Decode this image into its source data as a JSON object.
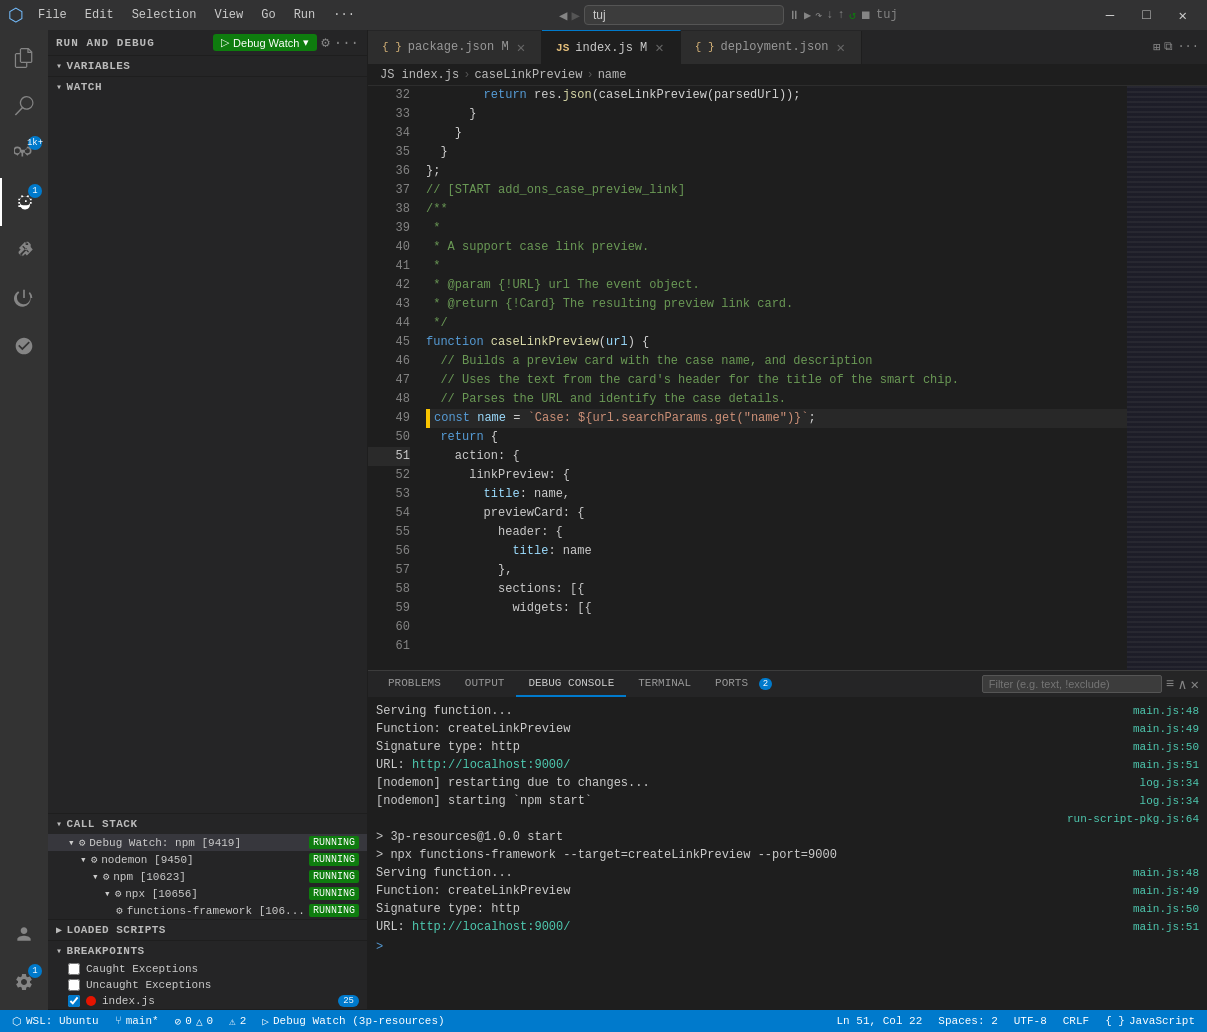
{
  "titleBar": {
    "menuItems": [
      "File",
      "Edit",
      "Selection",
      "View",
      "Go",
      "Run",
      "···"
    ],
    "searchPlaceholder": "tuj",
    "windowControls": [
      "—",
      "□",
      "✕"
    ]
  },
  "activityBar": {
    "icons": [
      {
        "name": "explorer-icon",
        "symbol": "⎘",
        "active": false
      },
      {
        "name": "search-icon",
        "symbol": "🔍",
        "active": false
      },
      {
        "name": "source-control-icon",
        "symbol": "⑂",
        "badge": "1k+",
        "active": false
      },
      {
        "name": "debug-icon",
        "symbol": "▷",
        "active": true,
        "badge": "1"
      },
      {
        "name": "extensions-icon",
        "symbol": "⊞",
        "active": false
      },
      {
        "name": "testing-icon",
        "symbol": "⚗",
        "active": false
      },
      {
        "name": "remote-icon",
        "symbol": "⚙",
        "active": false
      }
    ],
    "bottomIcons": [
      {
        "name": "account-icon",
        "symbol": "👤"
      },
      {
        "name": "settings-icon",
        "symbol": "⚙",
        "badge": "1"
      }
    ]
  },
  "sidebar": {
    "title": "RUN AND DEBUG",
    "debugConfig": "Debug Watch",
    "sections": {
      "variables": {
        "label": "VARIABLES",
        "collapsed": false
      },
      "watch": {
        "label": "WATCH",
        "collapsed": false
      },
      "callStack": {
        "label": "CALL STACK",
        "items": [
          {
            "icon": "⚙",
            "label": "Debug Watch: npm [9419]",
            "status": "RUNNING",
            "children": [
              {
                "icon": "⚙",
                "label": "nodemon [9450]",
                "status": "RUNNING",
                "children": [
                  {
                    "icon": "⚙",
                    "label": "npm [10623]",
                    "status": "RUNNING",
                    "children": [
                      {
                        "icon": "⚙",
                        "label": "npx [10656]",
                        "status": "RUNNING",
                        "children": [
                          {
                            "icon": "⚙",
                            "label": "functions-framework [106...",
                            "status": "RUNNING"
                          }
                        ]
                      }
                    ]
                  }
                ]
              }
            ]
          }
        ]
      },
      "loadedScripts": {
        "label": "LOADED SCRIPTS",
        "collapsed": true
      },
      "breakpoints": {
        "label": "BREAKPOINTS",
        "items": [
          {
            "type": "checkbox",
            "label": "Caught Exceptions",
            "checked": false
          },
          {
            "type": "checkbox",
            "label": "Uncaught Exceptions",
            "checked": false
          },
          {
            "type": "dot",
            "label": "index.js",
            "checked": true,
            "count": "25"
          }
        ]
      }
    }
  },
  "tabs": [
    {
      "label": "package.json",
      "icon": "{ }",
      "modified": true,
      "active": false
    },
    {
      "label": "index.js",
      "icon": "JS",
      "modified": true,
      "active": true
    },
    {
      "label": "deployment.json",
      "icon": "{ }",
      "active": false
    }
  ],
  "breadcrumb": [
    "JS index.js",
    "caseLinkPreview",
    "name"
  ],
  "editor": {
    "lines": [
      {
        "num": 32,
        "content": "        return res.json(caseLinkPreview(parsedUrl));",
        "tokens": [
          {
            "text": "        ",
            "class": ""
          },
          {
            "text": "return",
            "class": "kw"
          },
          {
            "text": " res.",
            "class": ""
          },
          {
            "text": "json",
            "class": "fn"
          },
          {
            "text": "(caseLinkPreview(parsedUrl));",
            "class": ""
          }
        ]
      },
      {
        "num": 33,
        "content": "      }",
        "tokens": [
          {
            "text": "      }",
            "class": "punc"
          }
        ]
      },
      {
        "num": 34,
        "content": "    }",
        "tokens": [
          {
            "text": "    }",
            "class": "punc"
          }
        ]
      },
      {
        "num": 35,
        "content": "  }",
        "tokens": [
          {
            "text": "  }",
            "class": "punc"
          }
        ]
      },
      {
        "num": 36,
        "content": "};",
        "tokens": [
          {
            "text": "};",
            "class": "punc"
          }
        ]
      },
      {
        "num": 37,
        "content": "",
        "tokens": []
      },
      {
        "num": 38,
        "content": "// [START add_ons_case_preview_link]",
        "tokens": [
          {
            "text": "// [START add_ons_case_preview_link]",
            "class": "comment"
          }
        ]
      },
      {
        "num": 39,
        "content": "",
        "tokens": []
      },
      {
        "num": 40,
        "content": "/**",
        "tokens": [
          {
            "text": "/**",
            "class": "comment"
          }
        ]
      },
      {
        "num": 41,
        "content": " *",
        "tokens": [
          {
            "text": " *",
            "class": "comment"
          }
        ]
      },
      {
        "num": 42,
        "content": " * A support case link preview.",
        "tokens": [
          {
            "text": " * A support case link preview.",
            "class": "comment"
          }
        ]
      },
      {
        "num": 43,
        "content": " *",
        "tokens": [
          {
            "text": " *",
            "class": "comment"
          }
        ]
      },
      {
        "num": 44,
        "content": " * @param {!URL} url The event object.",
        "tokens": [
          {
            "text": " * @param {!URL} url The event object.",
            "class": "comment"
          }
        ]
      },
      {
        "num": 45,
        "content": " * @return {!Card} The resulting preview link card.",
        "tokens": [
          {
            "text": " * @return {!Card} The resulting preview link card.",
            "class": "comment"
          }
        ]
      },
      {
        "num": 46,
        "content": " */",
        "tokens": [
          {
            "text": " */",
            "class": "comment"
          }
        ]
      },
      {
        "num": 47,
        "content": "function caseLinkPreview(url) {",
        "tokens": [
          {
            "text": "function ",
            "class": "kw"
          },
          {
            "text": "caseLinkPreview",
            "class": "fn"
          },
          {
            "text": "(",
            "class": "punc"
          },
          {
            "text": "url",
            "class": "param"
          },
          {
            "text": ") {",
            "class": "punc"
          }
        ]
      },
      {
        "num": 48,
        "content": "  // Builds a preview card with the case name, and description",
        "tokens": [
          {
            "text": "  // Builds a preview card with the case name, and description",
            "class": "comment"
          }
        ]
      },
      {
        "num": 49,
        "content": "  // Uses the text from the card's header for the title of the smart chip.",
        "tokens": [
          {
            "text": "  // Uses the text from the card's header for the title of the smart chip.",
            "class": "comment"
          }
        ]
      },
      {
        "num": 50,
        "content": "  // Parses the URL and identify the case details.",
        "tokens": [
          {
            "text": "  // Parses the URL and identify the case details.",
            "class": "comment"
          }
        ]
      },
      {
        "num": 51,
        "content": "  const name = `Case: ${url.searchParams.get(\"name\")}`;",
        "active": true,
        "tokens": [
          {
            "text": "  ",
            "class": ""
          },
          {
            "text": "const",
            "class": "kw"
          },
          {
            "text": " ",
            "class": ""
          },
          {
            "text": "name",
            "class": "param"
          },
          {
            "text": " = ",
            "class": "op"
          },
          {
            "text": "`Case: ${url.searchParams.get(\"name\")}`",
            "class": "str"
          },
          {
            "text": ";",
            "class": "punc"
          }
        ]
      },
      {
        "num": 52,
        "content": "  return {",
        "tokens": [
          {
            "text": "  ",
            "class": ""
          },
          {
            "text": "return",
            "class": "kw"
          },
          {
            "text": " {",
            "class": "punc"
          }
        ]
      },
      {
        "num": 53,
        "content": "    action: {",
        "tokens": [
          {
            "text": "    action: {",
            "class": ""
          }
        ]
      },
      {
        "num": 54,
        "content": "      linkPreview: {",
        "tokens": [
          {
            "text": "      linkPreview: {",
            "class": ""
          }
        ]
      },
      {
        "num": 55,
        "content": "        title: name,",
        "tokens": [
          {
            "text": "        ",
            "class": ""
          },
          {
            "text": "title",
            "class": "prop"
          },
          {
            "text": ": name,",
            "class": ""
          }
        ]
      },
      {
        "num": 56,
        "content": "        previewCard: {",
        "tokens": [
          {
            "text": "        previewCard: {",
            "class": ""
          }
        ]
      },
      {
        "num": 57,
        "content": "          header: {",
        "tokens": [
          {
            "text": "          header: {",
            "class": ""
          }
        ]
      },
      {
        "num": 58,
        "content": "            title: name",
        "tokens": [
          {
            "text": "            ",
            "class": ""
          },
          {
            "text": "title",
            "class": "prop"
          },
          {
            "text": ": name",
            "class": ""
          }
        ]
      },
      {
        "num": 59,
        "content": "          },",
        "tokens": [
          {
            "text": "          },",
            "class": "punc"
          }
        ]
      },
      {
        "num": 60,
        "content": "          sections: [{",
        "tokens": [
          {
            "text": "          sections: [{",
            "class": ""
          }
        ]
      },
      {
        "num": 61,
        "content": "            widgets: [{",
        "tokens": [
          {
            "text": "            widgets: [{",
            "class": ""
          }
        ]
      }
    ]
  },
  "panel": {
    "tabs": [
      {
        "label": "PROBLEMS",
        "active": false
      },
      {
        "label": "OUTPUT",
        "active": false
      },
      {
        "label": "DEBUG CONSOLE",
        "active": true
      },
      {
        "label": "TERMINAL",
        "active": false
      },
      {
        "label": "PORTS",
        "active": false,
        "badge": "2"
      }
    ],
    "filterPlaceholder": "Filter (e.g. text, !exclude)",
    "console": {
      "lines": [
        {
          "text": "Serving function...",
          "link": "main.js:48"
        },
        {
          "text": "Function: createLinkPreview",
          "link": "main.js:49"
        },
        {
          "text": "Signature type: http",
          "link": "main.js:50"
        },
        {
          "text": "URL: http://localhost:9000/",
          "link": "main.js:51"
        },
        {
          "text": "[nodemon] restarting due to changes...",
          "link": "log.js:34"
        },
        {
          "text": "[nodemon] starting `npm start`",
          "link": "log.js:34"
        },
        {
          "text": "",
          "link": "run-script-pkg.js:64"
        },
        {
          "text": "> 3p-resources@1.0.0 start",
          "link": ""
        },
        {
          "text": "> npx functions-framework --target=createLinkPreview --port=9000",
          "link": ""
        },
        {
          "text": "",
          "link": ""
        },
        {
          "text": "Serving function...",
          "link": "main.js:48"
        },
        {
          "text": "Function: createLinkPreview",
          "link": "main.js:49"
        },
        {
          "text": "Signature type: http",
          "link": "main.js:50"
        },
        {
          "text": "URL: http://localhost:9000/",
          "link": "main.js:51"
        }
      ],
      "inputPrompt": ">"
    }
  },
  "statusBar": {
    "left": [
      {
        "text": "WSL: Ubuntu",
        "icon": "🔗"
      },
      {
        "text": "main*",
        "icon": "⑂"
      },
      {
        "text": "0 ⊘ 0 △",
        "icon": ""
      },
      {
        "text": "2",
        "icon": "⚠"
      },
      {
        "text": "Debug Watch (3p-resources)",
        "icon": "▷"
      }
    ],
    "right": [
      {
        "text": "Ln 51, Col 22"
      },
      {
        "text": "Spaces: 2"
      },
      {
        "text": "UTF-8"
      },
      {
        "text": "CRLF"
      },
      {
        "text": "{ } JavaScript"
      }
    ]
  }
}
